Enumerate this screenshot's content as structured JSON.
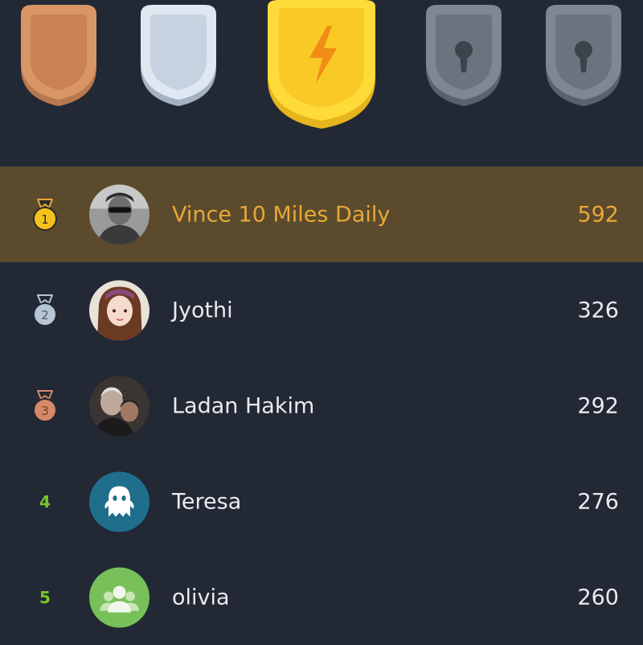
{
  "badges": [
    {
      "icon": "bronze-shield-icon",
      "state": "unlocked"
    },
    {
      "icon": "silver-shield-icon",
      "state": "unlocked"
    },
    {
      "icon": "gold-lightning-shield-icon",
      "state": "current"
    },
    {
      "icon": "locked-shield-icon",
      "state": "locked"
    },
    {
      "icon": "locked-shield-icon",
      "state": "locked"
    }
  ],
  "colors": {
    "background": "#222834",
    "highlight_row": "#5b4b2c",
    "highlight_text": "#e8a838",
    "rank_number": "#7ac62b"
  },
  "leaderboard": [
    {
      "rank": "1",
      "medal": "gold-medal-icon",
      "name": "Vince 10 Miles Daily",
      "score": "592"
    },
    {
      "rank": "2",
      "medal": "silver-medal-icon",
      "name": "Jyothi",
      "score": "326"
    },
    {
      "rank": "3",
      "medal": "bronze-medal-icon",
      "name": "Ladan Hakim",
      "score": "292"
    },
    {
      "rank": "4",
      "medal": "",
      "name": "Teresa",
      "score": "276"
    },
    {
      "rank": "5",
      "medal": "",
      "name": "olivia",
      "score": "260"
    }
  ]
}
